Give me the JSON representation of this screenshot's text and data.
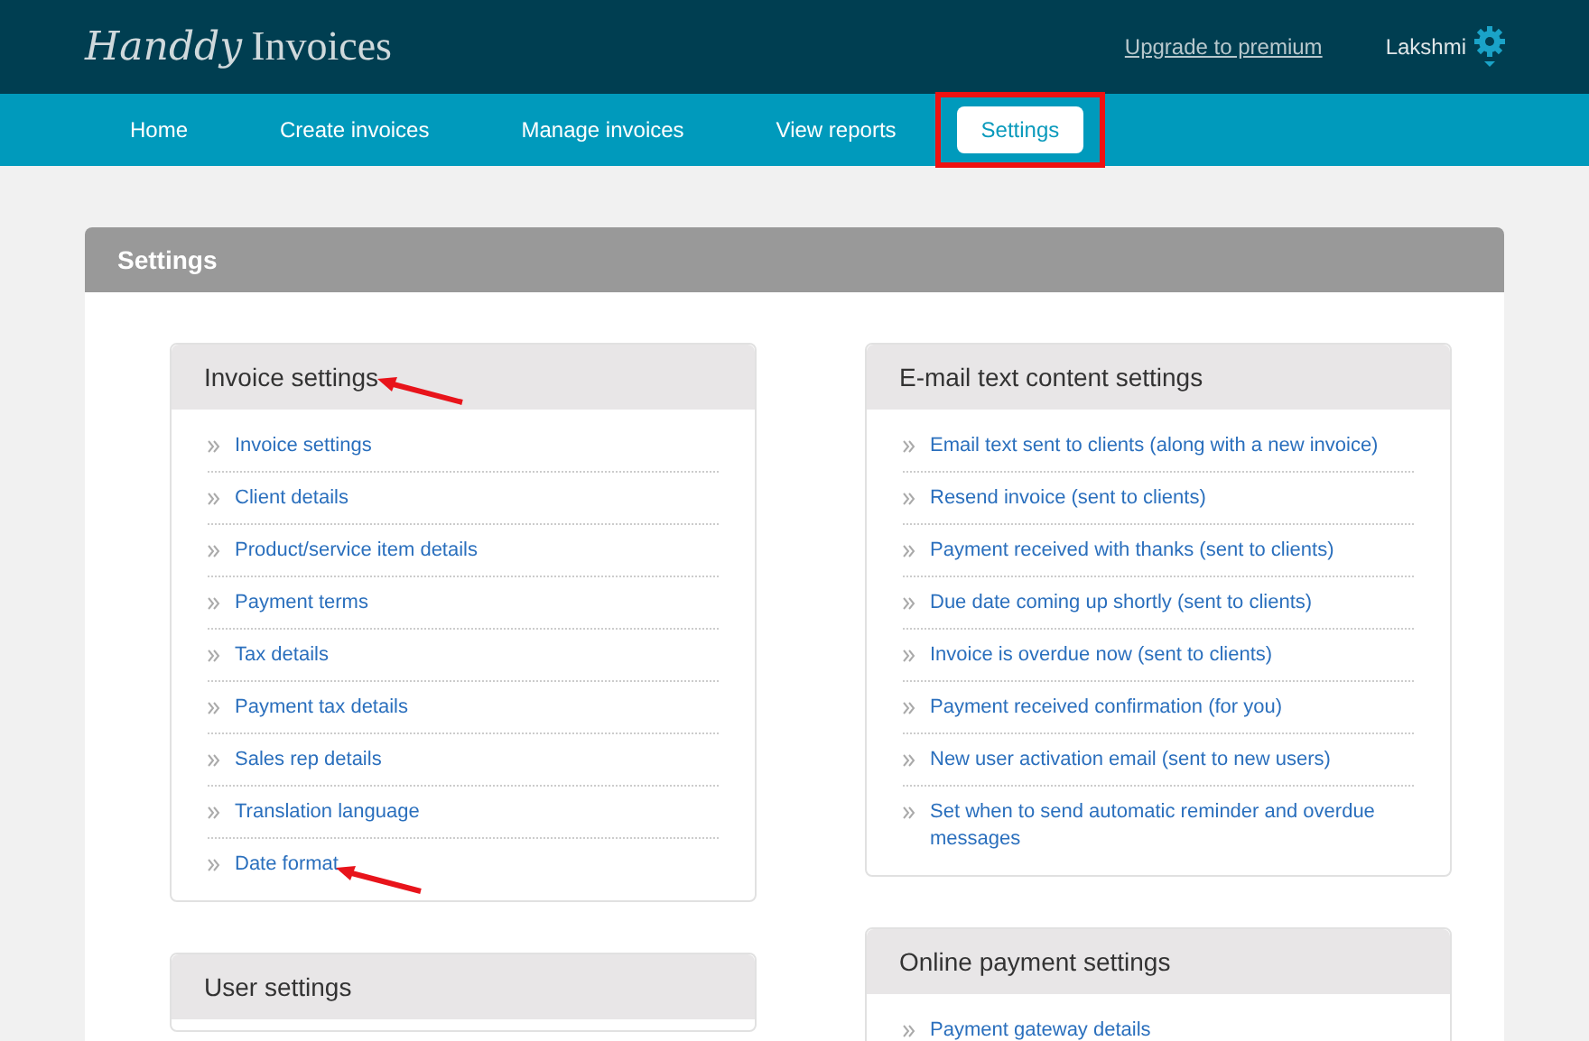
{
  "header": {
    "logo_script": "Handdy",
    "logo_text": "Invoices",
    "upgrade_link": "Upgrade to premium",
    "user": "Lakshmi"
  },
  "nav": [
    {
      "label": "Home",
      "selected": false
    },
    {
      "label": "Create invoices",
      "selected": false
    },
    {
      "label": "Manage invoices",
      "selected": false
    },
    {
      "label": "View reports",
      "selected": false
    },
    {
      "label": "Settings",
      "selected": true
    }
  ],
  "panel": {
    "title": "Settings",
    "columns": [
      [
        {
          "title": "Invoice settings",
          "arrow": true,
          "items": [
            {
              "label": "Invoice settings",
              "arrow": false
            },
            {
              "label": "Client details",
              "arrow": false
            },
            {
              "label": "Product/service item details",
              "arrow": false
            },
            {
              "label": "Payment terms",
              "arrow": false
            },
            {
              "label": "Tax details",
              "arrow": false
            },
            {
              "label": "Payment tax details",
              "arrow": false
            },
            {
              "label": "Sales rep details",
              "arrow": false
            },
            {
              "label": "Translation language",
              "arrow": false
            },
            {
              "label": "Date format",
              "arrow": true
            }
          ]
        },
        {
          "title": "User settings",
          "arrow": false
        }
      ],
      [
        {
          "title": "E-mail text content settings",
          "arrow": false,
          "items": [
            {
              "label": "Email text sent to clients (along with a new invoice)",
              "arrow": false
            },
            {
              "label": "Resend invoice (sent to clients)",
              "arrow": false
            },
            {
              "label": "Payment received with thanks (sent to clients)",
              "arrow": false
            },
            {
              "label": "Due date coming up shortly (sent to clients)",
              "arrow": false
            },
            {
              "label": "Invoice is overdue now (sent to clients)",
              "arrow": false
            },
            {
              "label": "Payment received confirmation (for you)",
              "arrow": false
            },
            {
              "label": "New user activation email (sent to new users)",
              "arrow": false
            },
            {
              "label": "Set when to send automatic reminder and overdue messages",
              "arrow": false
            }
          ]
        },
        {
          "title": "Online payment settings",
          "arrow": false,
          "items": [
            {
              "label": "Payment gateway details",
              "arrow": false
            }
          ]
        }
      ]
    ]
  }
}
